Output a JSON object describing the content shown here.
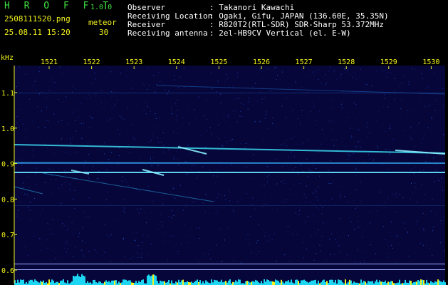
{
  "app": {
    "name": "H R O F F T",
    "version": "1.0.0"
  },
  "file": {
    "name": "2508111520.png",
    "datetime": "25.08.11 15:20"
  },
  "counter": {
    "label": "meteor",
    "value": "30"
  },
  "info": [
    {
      "label": "Observer",
      "value": ": Takanori Kawachi"
    },
    {
      "label": "Receiving Location",
      "value": ": Ogaki, Gifu, JAPAN (136.60E, 35.35N)"
    },
    {
      "label": "Receiver",
      "value": ": R820T2(RTL-SDR) SDR-Sharp 53.372MHz"
    },
    {
      "label": "Receiving antenna",
      "value": ": 2el-HB9CV Vertical (el. E-W)"
    }
  ],
  "spectrogram": {
    "unit": "kHz",
    "time_ticks": [
      "1521",
      "1522",
      "1523",
      "1524",
      "1525",
      "1526",
      "1527",
      "1528",
      "1529",
      "1530"
    ],
    "freq_ticks": [
      "1.1",
      "1.0",
      "0.9",
      "0.8",
      "0.7",
      "0.6"
    ],
    "colors": {
      "background": "#06063a",
      "axis": "#f2f21e",
      "signal": "#3ad8f0",
      "ambient": "#1cd6f2"
    }
  }
}
